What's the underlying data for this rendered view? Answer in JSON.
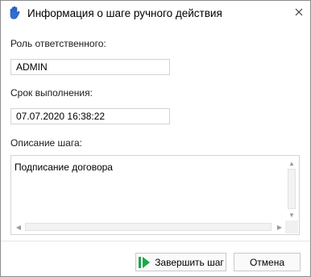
{
  "window": {
    "title": "Информация о шаге ручного действия",
    "icon": "hand-icon",
    "close_icon": "close-icon"
  },
  "form": {
    "responsible_label": "Роль ответственного:",
    "responsible_value": "ADMIN",
    "deadline_label": "Срок выполнения:",
    "deadline_value": "07.07.2020 16:38:22",
    "description_label": "Описание шага:",
    "description_value": "Подписание договора"
  },
  "buttons": {
    "finish_label": "Завершить шаг",
    "finish_icon": "play-step-icon",
    "cancel_label": "Отмена"
  },
  "colors": {
    "accent_blue": "#2f6fd6",
    "finish_green": "#1aa84a"
  }
}
